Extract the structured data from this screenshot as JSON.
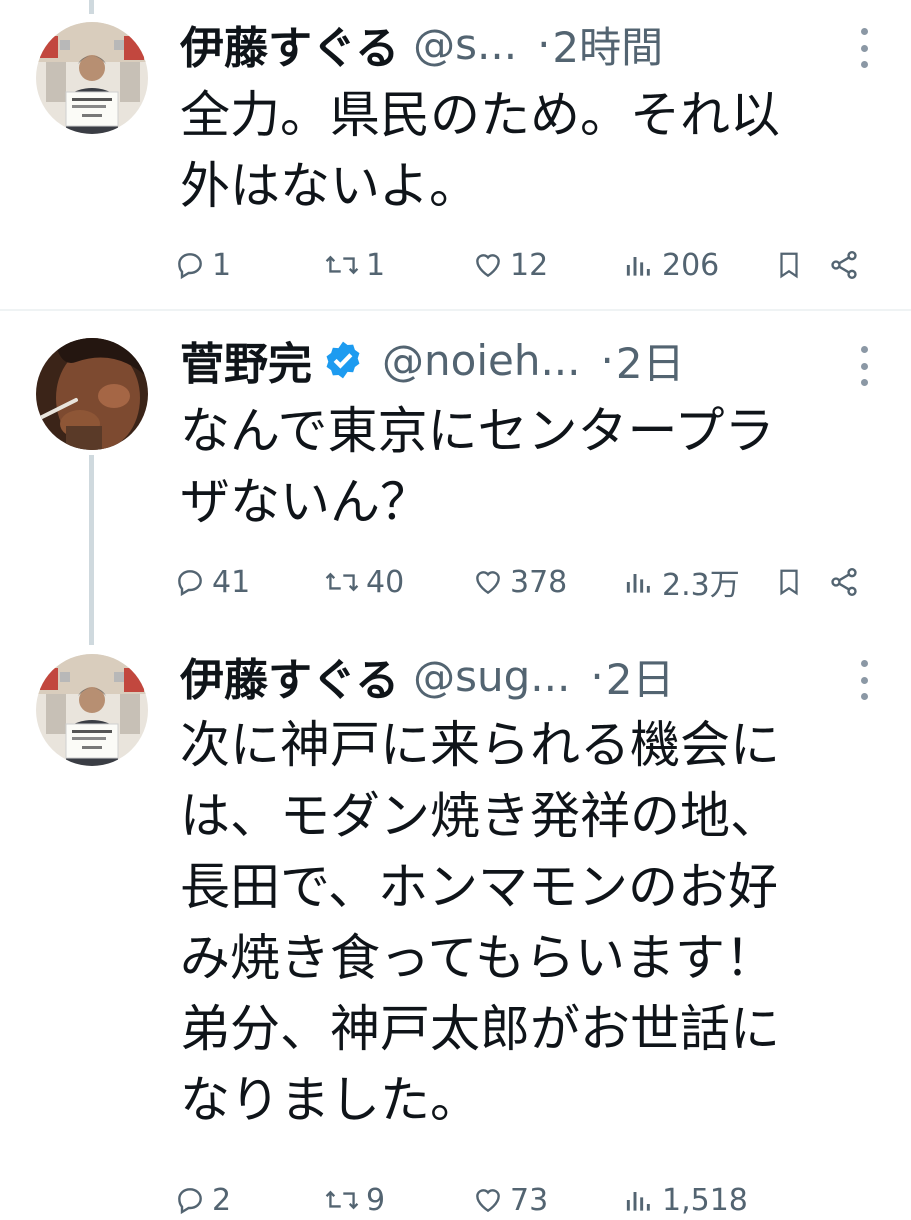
{
  "tweets": [
    {
      "name": "伊藤すぐる",
      "handle": "@s...",
      "time": "2時間",
      "text": "全力。県民のため。それ以外はないよ。",
      "text_lines": [
        "全力。県民のため。それ以",
        "外はないよ。"
      ],
      "replies": "1",
      "retweets": "1",
      "likes": "12",
      "views": "206"
    },
    {
      "name": "菅野完",
      "verified": true,
      "handle": "@noieh...",
      "time": "2日",
      "text_lines": [
        "なんで東京にセンタープラ",
        "ザないん？"
      ],
      "replies": "41",
      "retweets": "40",
      "likes": "378",
      "views": "2.3万"
    },
    {
      "name": "伊藤すぐる",
      "handle": "@sug...",
      "time": "2日",
      "text_lines": [
        "次に神戸に来られる機会に",
        "は、モダン焼き発祥の地、",
        "長田で、ホンマモンのお好",
        "み焼き食ってもらいます！",
        "弟分、神戸太郎がお世話に",
        "なりました。"
      ],
      "replies": "2",
      "retweets": "9",
      "likes": "73",
      "views": "1,518"
    }
  ],
  "colors": {
    "text": "#0f1419",
    "muted": "#536471",
    "verified": "#1d9bf0",
    "thread_line": "#cfd9de"
  },
  "icons": [
    "reply-icon",
    "retweet-icon",
    "like-icon",
    "views-icon",
    "bookmark-icon",
    "share-icon",
    "more-icon",
    "verified-badge-icon"
  ]
}
